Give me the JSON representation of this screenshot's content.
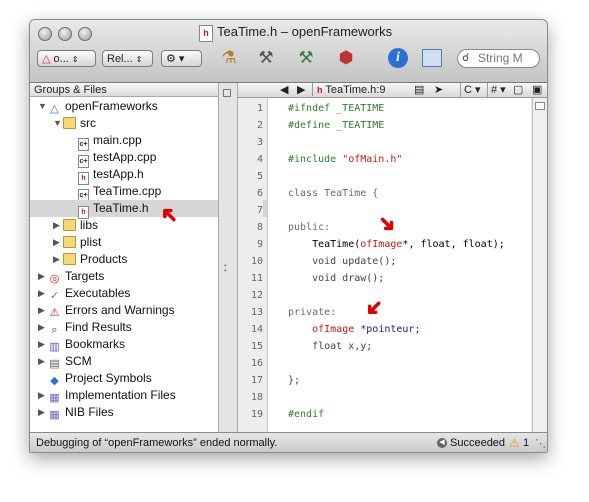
{
  "window": {
    "title": "TeaTime.h – openFrameworks",
    "doc_icon": "h"
  },
  "toolbar": {
    "target_popup": "o...",
    "config_popup": "Rel...",
    "action_popup": "⚙ ▾",
    "search_placeholder": "String M"
  },
  "sidebar": {
    "header": "Groups & Files",
    "items": [
      {
        "label": "openFrameworks",
        "icon": "project-icon",
        "indent": 0,
        "disclosure": "▼"
      },
      {
        "label": "src",
        "icon": "folder-icon",
        "indent": 1,
        "disclosure": "▼"
      },
      {
        "label": "main.cpp",
        "icon": "cpp-file-icon",
        "indent": 2,
        "disclosure": ""
      },
      {
        "label": "testApp.cpp",
        "icon": "cpp-file-icon",
        "indent": 2,
        "disclosure": ""
      },
      {
        "label": "testApp.h",
        "icon": "header-file-icon",
        "indent": 2,
        "disclosure": ""
      },
      {
        "label": "TeaTime.cpp",
        "icon": "cpp-file-icon",
        "indent": 2,
        "disclosure": ""
      },
      {
        "label": "TeaTime.h",
        "icon": "header-file-icon",
        "indent": 2,
        "disclosure": "",
        "selected": true
      },
      {
        "label": "libs",
        "icon": "folder-icon",
        "indent": 1,
        "disclosure": "▶"
      },
      {
        "label": "plist",
        "icon": "folder-icon",
        "indent": 1,
        "disclosure": "▶"
      },
      {
        "label": "Products",
        "icon": "folder-icon",
        "indent": 1,
        "disclosure": "▶"
      },
      {
        "label": "Targets",
        "icon": "target-icon",
        "indent": 0,
        "disclosure": "▶"
      },
      {
        "label": "Executables",
        "icon": "executable-icon",
        "indent": 0,
        "disclosure": "▶"
      },
      {
        "label": "Errors and Warnings",
        "icon": "warning-icon",
        "indent": 0,
        "disclosure": "▶"
      },
      {
        "label": "Find Results",
        "icon": "find-icon",
        "indent": 0,
        "disclosure": "▶"
      },
      {
        "label": "Bookmarks",
        "icon": "bookmark-icon",
        "indent": 0,
        "disclosure": "▶"
      },
      {
        "label": "SCM",
        "icon": "scm-icon",
        "indent": 0,
        "disclosure": "▶"
      },
      {
        "label": "Project Symbols",
        "icon": "symbols-icon",
        "indent": 0,
        "disclosure": ""
      },
      {
        "label": "Implementation Files",
        "icon": "smart-group-icon",
        "indent": 0,
        "disclosure": "▶"
      },
      {
        "label": "NIB Files",
        "icon": "smart-group-icon",
        "indent": 0,
        "disclosure": "▶"
      }
    ]
  },
  "editor": {
    "file_popup": "TeaTime.h:9",
    "symbol_popup": "C",
    "include_popup": "#",
    "lines": [
      {
        "n": "1",
        "segs": [
          {
            "t": "#ifndef _TEATIME",
            "c": "#2e7d32"
          }
        ]
      },
      {
        "n": "2",
        "segs": [
          {
            "t": "#define _TEATIME",
            "c": "#2e7d32"
          }
        ]
      },
      {
        "n": "3",
        "segs": []
      },
      {
        "n": "4",
        "segs": [
          {
            "t": "#include ",
            "c": "#2e7d32"
          },
          {
            "t": "\"ofMain.h\"",
            "c": "#c41a16"
          }
        ]
      },
      {
        "n": "5",
        "segs": []
      },
      {
        "n": "6",
        "segs": [
          {
            "t": "class TeaTime {",
            "c": "#6b6b6b"
          }
        ]
      },
      {
        "n": "7",
        "segs": []
      },
      {
        "n": "8",
        "segs": [
          {
            "t": "public:",
            "c": "#6b6b6b"
          }
        ]
      },
      {
        "n": "9",
        "segs": [
          {
            "t": "    TeaTime(",
            "c": "#000000"
          },
          {
            "t": "ofImage",
            "c": "#c41a16"
          },
          {
            "t": "*",
            "c": "#000000"
          },
          {
            "t": ", float, float);",
            "c": "#000000"
          }
        ]
      },
      {
        "n": "10",
        "segs": [
          {
            "t": "    void update();",
            "c": "#444444"
          }
        ]
      },
      {
        "n": "11",
        "segs": [
          {
            "t": "    void draw();",
            "c": "#444444"
          }
        ]
      },
      {
        "n": "12",
        "segs": []
      },
      {
        "n": "13",
        "segs": [
          {
            "t": "private:",
            "c": "#6b6b6b"
          }
        ]
      },
      {
        "n": "14",
        "segs": [
          {
            "t": "    ",
            "c": "#000000"
          },
          {
            "t": "ofImage",
            "c": "#c41a16"
          },
          {
            "t": " *pointeur;",
            "c": "#1a1aa6"
          }
        ]
      },
      {
        "n": "15",
        "segs": [
          {
            "t": "    float x,y;",
            "c": "#444444"
          }
        ]
      },
      {
        "n": "16",
        "segs": []
      },
      {
        "n": "17",
        "segs": [
          {
            "t": "};",
            "c": "#444444"
          }
        ]
      },
      {
        "n": "18",
        "segs": []
      },
      {
        "n": "19",
        "segs": [
          {
            "t": "#endif",
            "c": "#2e7d32"
          }
        ]
      }
    ]
  },
  "status": {
    "message": "Debugging of “openFrameworks” ended normally.",
    "result": "Succeeded",
    "warning_count": "1"
  },
  "colors": {
    "annotation_arrow": "#e00000",
    "selection": "#d6d6d6"
  }
}
